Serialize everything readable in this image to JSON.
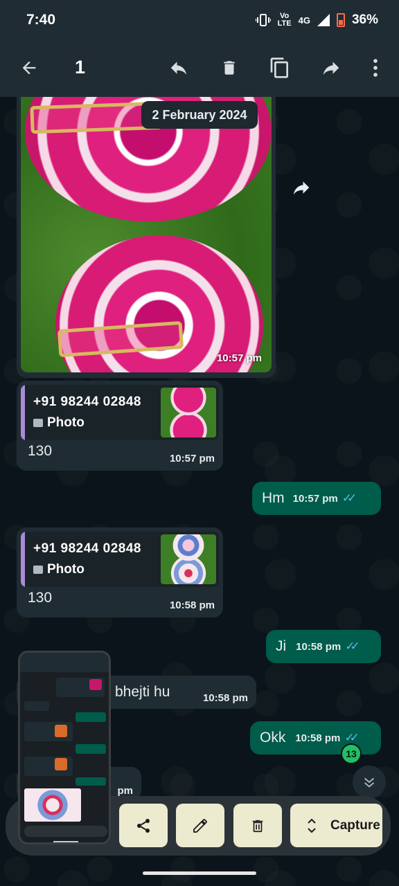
{
  "status_bar": {
    "time": "7:40",
    "network_top": "Vo",
    "network_bottom": "LTE",
    "network_gen": "4G",
    "battery": "36%"
  },
  "action_bar": {
    "selected_count": "1"
  },
  "date_chip": "2 February 2024",
  "messages": {
    "image_time": "10:57 pm",
    "reply1": {
      "quote_name": "+91 98244 02848",
      "quote_type": "Photo",
      "text": "130",
      "time": "10:57 pm"
    },
    "sent1": {
      "text": "Hm",
      "time": "10:57 pm"
    },
    "reply2": {
      "quote_name": "+91 98244 02848",
      "quote_type": "Photo",
      "text": "130",
      "time": "10:58 pm"
    },
    "sent2": {
      "text": "Ji",
      "time": "10:58 pm"
    },
    "received3": {
      "text": "bhejti hu",
      "time": "10:58 pm"
    },
    "sent3": {
      "text": "Okk",
      "time": "10:58 pm"
    },
    "received4": {
      "time": "pm"
    }
  },
  "unread_badge": "13",
  "capture_tray": {
    "capture_label": "Capture"
  },
  "colors": {
    "incoming": "#202c33",
    "outgoing": "#005c4b",
    "header": "#1f2c34",
    "read_ticks": "#53bdeb",
    "tray_button": "#ecebd0"
  }
}
